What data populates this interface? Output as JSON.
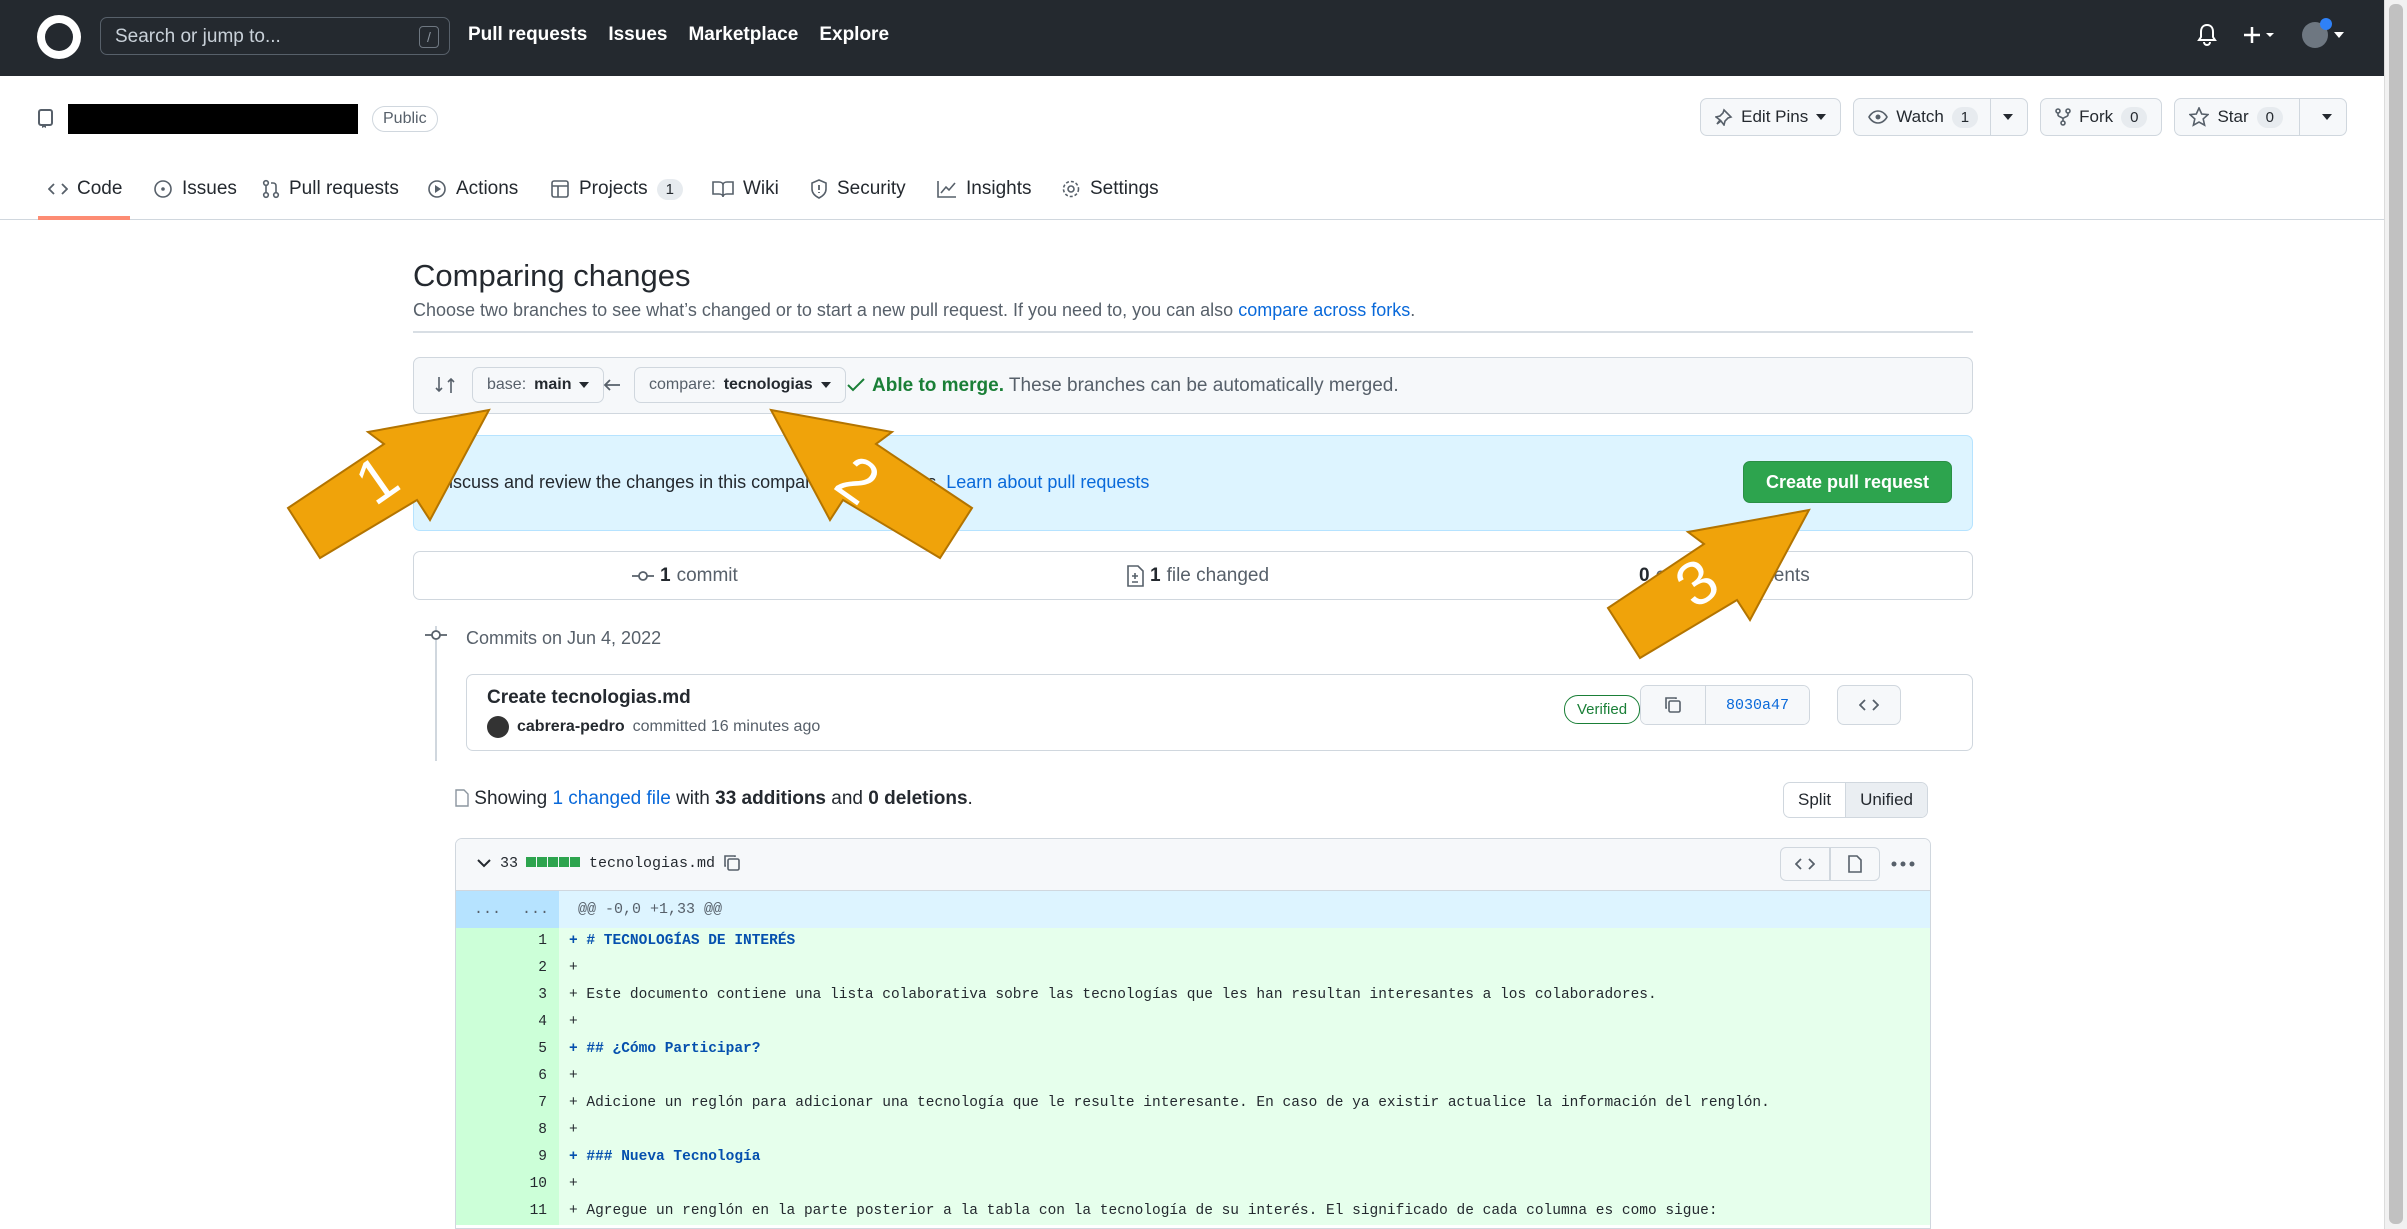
{
  "header": {
    "search_placeholder": "Search or jump to...",
    "slash_key": "/",
    "nav": [
      "Pull requests",
      "Issues",
      "Marketplace",
      "Explore"
    ]
  },
  "repo": {
    "visibility": "Public",
    "actions": {
      "edit_pins": "Edit Pins",
      "watch": "Watch",
      "watch_count": "1",
      "fork": "Fork",
      "fork_count": "0",
      "star": "Star",
      "star_count": "0"
    },
    "tabs": [
      "Code",
      "Issues",
      "Pull requests",
      "Actions",
      "Projects",
      "Wiki",
      "Security",
      "Insights",
      "Settings"
    ],
    "projects_count": "1"
  },
  "compare": {
    "title": "Comparing changes",
    "subtitle": "Choose two branches to see what’s changed or to start a new pull request. If you need to, you can also",
    "subtitle_link": "compare across forks",
    "base_label": "base:",
    "base_branch": "main",
    "compare_label": "compare:",
    "compare_branch": "tecnologias",
    "merge_status": "Able to merge.",
    "merge_detail": "These branches can be automatically merged.",
    "flash_text": "Discuss and review the changes in this comparison with others.",
    "flash_link": "Learn about pull requests",
    "create_button": "Create pull request"
  },
  "stats": {
    "commits_num": "1",
    "commits_label": "commit",
    "files_num": "1",
    "files_label": "file changed",
    "contributors_num": "0",
    "contributors_label": "commit comments"
  },
  "commits": {
    "date_label": "Commits on Jun 4, 2022",
    "title": "Create tecnologias.md",
    "author": "cabrera-pedro",
    "committed_text": "committed 16 minutes ago",
    "verified": "Verified",
    "sha": "8030a47"
  },
  "summary": {
    "showing": "Showing",
    "changed_files": "1 changed file",
    "with": "with",
    "additions": "33 additions",
    "and": "and",
    "deletions": "0 deletions",
    "split": "Split",
    "unified": "Unified"
  },
  "diff": {
    "count": "33",
    "filename": "tecnologias.md",
    "hunk_ellipsis_left": "...",
    "hunk_ellipsis_right": "...",
    "hunk_header": "@@ -0,0 +1,33 @@",
    "lines": [
      {
        "n": "1",
        "text": "+ # TECNOLOGÍAS DE INTERÉS",
        "heading": true
      },
      {
        "n": "2",
        "text": "+",
        "heading": false
      },
      {
        "n": "3",
        "text": "+ Este documento contiene una lista colaborativa sobre las tecnologías que les han resultan interesantes a los colaboradores.",
        "heading": false
      },
      {
        "n": "4",
        "text": "+",
        "heading": false
      },
      {
        "n": "5",
        "text": "+ ## ¿Cómo Participar?",
        "heading": true
      },
      {
        "n": "6",
        "text": "+",
        "heading": false
      },
      {
        "n": "7",
        "text": "+ Adicione un reglón para adicionar una tecnología que le resulte interesante. En caso de ya existir actualice la información del renglón.",
        "heading": false
      },
      {
        "n": "8",
        "text": "+",
        "heading": false
      },
      {
        "n": "9",
        "text": "+ ### Nueva Tecnología",
        "heading": true
      },
      {
        "n": "10",
        "text": "+",
        "heading": false
      },
      {
        "n": "11",
        "text": "+ Agregue un renglón en la parte posterior a la tabla con la tecnología de su interés. El significado de cada columna es como sigue:",
        "heading": false
      }
    ]
  },
  "annotations": [
    "1",
    "2",
    "3"
  ],
  "colors": {
    "arrow": "#f0a30a",
    "create_button": "#2da44e",
    "header": "#24292f"
  }
}
